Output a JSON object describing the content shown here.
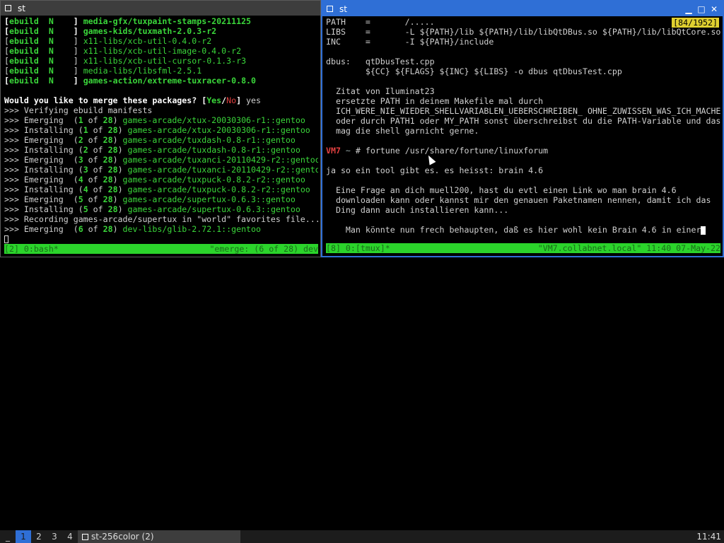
{
  "left_window": {
    "title": "st",
    "lines": [
      {
        "a": "[",
        "b": "ebuild  N    ",
        "c": "] ",
        "d": "media-gfx/tuxpaint-stamps-20211125",
        "bold": true
      },
      {
        "a": "[",
        "b": "ebuild  N    ",
        "c": "] ",
        "d": "games-kids/tuxmath-2.0.3-r2",
        "bold": true
      },
      {
        "a": "[",
        "b": "ebuild  N    ",
        "c": "] ",
        "d": "x11-libs/xcb-util-0.4.0-r2",
        "bold": false
      },
      {
        "a": "[",
        "b": "ebuild  N    ",
        "c": "] ",
        "d": "x11-libs/xcb-util-image-0.4.0-r2",
        "bold": false
      },
      {
        "a": "[",
        "b": "ebuild  N    ",
        "c": "] ",
        "d": "x11-libs/xcb-util-cursor-0.1.3-r3",
        "bold": false
      },
      {
        "a": "[",
        "b": "ebuild  N    ",
        "c": "] ",
        "d": "media-libs/libsfml-2.5.1",
        "bold": false
      },
      {
        "a": "[",
        "b": "ebuild  N    ",
        "c": "] ",
        "d": "games-action/extreme-tuxracer-0.8.0",
        "bold": true
      }
    ],
    "merge_prompt": "Would you like to merge these packages?",
    "merge_yes": "Yes",
    "merge_slash": "/",
    "merge_no": "No",
    "merge_answer": "yes",
    "verify": ">>> Verifying ebuild manifests",
    "progress": [
      {
        "verb": ">>> Emerging  ",
        "n": "1",
        "pkg": "games-arcade/xtux-20030306-r1::gentoo"
      },
      {
        "verb": ">>> Installing ",
        "n": "1",
        "pkg": "games-arcade/xtux-20030306-r1::gentoo"
      },
      {
        "verb": ">>> Emerging  ",
        "n": "2",
        "pkg": "games-arcade/tuxdash-0.8-r1::gentoo"
      },
      {
        "verb": ">>> Installing ",
        "n": "2",
        "pkg": "games-arcade/tuxdash-0.8-r1::gentoo"
      },
      {
        "verb": ">>> Emerging  ",
        "n": "3",
        "pkg": "games-arcade/tuxanci-20110429-r2::gentoo"
      },
      {
        "verb": ">>> Installing ",
        "n": "3",
        "pkg": "games-arcade/tuxanci-20110429-r2::gentoo"
      },
      {
        "verb": ">>> Emerging  ",
        "n": "4",
        "pkg": "games-arcade/tuxpuck-0.8.2-r2::gentoo"
      },
      {
        "verb": ">>> Installing ",
        "n": "4",
        "pkg": "games-arcade/tuxpuck-0.8.2-r2::gentoo"
      },
      {
        "verb": ">>> Emerging  ",
        "n": "5",
        "pkg": "games-arcade/supertux-0.6.3::gentoo"
      },
      {
        "verb": ">>> Installing ",
        "n": "5",
        "pkg": "games-arcade/supertux-0.6.3::gentoo"
      }
    ],
    "recording": ">>> Recording games-arcade/supertux in \"world\" favorites file...",
    "last_emerge": {
      "verb": ">>> Emerging  ",
      "n": "6",
      "pkg": "dev-libs/glib-2.72.1::gentoo"
    },
    "of_total": "28",
    "status_left": "[2] 0:bash*",
    "status_right": "\"emerge: (6 of 28) dev"
  },
  "right_window": {
    "title": "st",
    "badge": "[84/1952]",
    "lines": [
      "PATH    =       /.....",
      "LIBS    =       -L ${PATH}/lib ${PATH}/lib/libQtDBus.so ${PATH}/lib/libQtCore.so",
      "INC     =       -I ${PATH}/include",
      "",
      "dbus:   qtDbusTest.cpp",
      "        ${CC} ${FLAGS} ${INC} ${LIBS} -o dbus qtDbusTest.cpp",
      "",
      "  Zitat von Iluminat23",
      "  ersetzte PATH in deinem Makefile mal durch",
      "  ICH_WERE_NIE_WIEDER_SHELLVARIABLEN_UEBERSCHREIBEN_ OHNE_ZUWISSEN_WAS_ICH_MACHE",
      "  oder durch PATH1 oder MY_PATH sonst überschreibst du die PATH-Variable und das",
      "  mag die shell garnicht gerne.",
      ""
    ],
    "prompt_host": "VM7",
    "prompt_dir": " ~ ",
    "prompt_sym": "#",
    "command": " fortune /usr/share/fortune/linuxforum",
    "lines2": [
      "",
      "ja so ein tool gibt es. es heisst: brain 4.6",
      "",
      "  Eine Frage an dich muell200, hast du evtl einen Link wo man brain 4.6",
      "  downloaden kann oder kannst mir den genauen Paketnamen nennen, damit ich das",
      "  Ding dann auch installieren kann...",
      ""
    ],
    "last_line": "    Man könnte nun frech behaupten, daß es hier wohl kein Brain 4.6 in einer",
    "status_left": "[8] 0:[tmux]*",
    "status_right": "\"VM7.collabnet.local\" 11:40 07-May-22"
  },
  "taskbar": {
    "workspaces": [
      "1",
      "2",
      "3",
      "4"
    ],
    "active_workspace": "1",
    "task_label": "st-256color (2)",
    "clock": "11:41"
  }
}
